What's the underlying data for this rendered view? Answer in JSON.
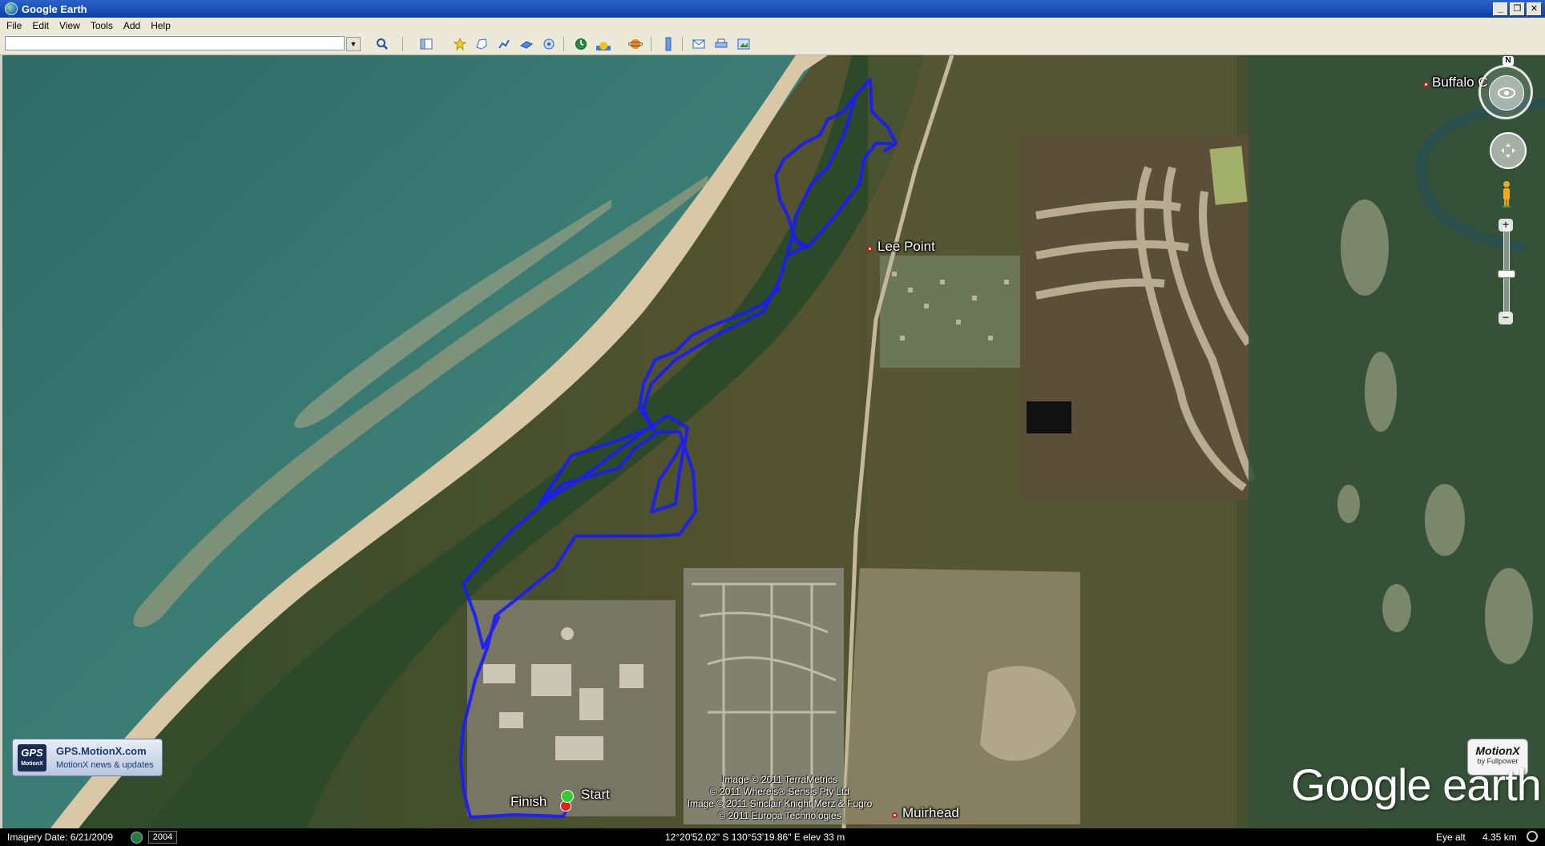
{
  "window": {
    "title": "Google Earth"
  },
  "menu": {
    "file": "File",
    "edit": "Edit",
    "view": "View",
    "tools": "Tools",
    "add": "Add",
    "help": "Help"
  },
  "search": {
    "value": "",
    "placeholder": ""
  },
  "toolbar_icons": [
    "search-icon",
    "sidebar-icon",
    "placemark-icon",
    "polygon-icon",
    "path-icon",
    "overlay-icon",
    "tour-icon",
    "historical-imagery-icon",
    "sun-icon",
    "planets-icon",
    "ruler-icon",
    "email-icon",
    "print-icon",
    "save-image-icon"
  ],
  "places": {
    "buffalo": "Buffalo C",
    "lee_point": "Lee Point",
    "muirhead": "Muirhead",
    "finish": "Finish",
    "start": "Start"
  },
  "credits": {
    "line1": "Image © 2011 TerraMetrics",
    "line2": "© 2011 Whereis® Sensis Pty Ltd",
    "line3": "Image © 2011 Sinclair Knight Merz & Fugro",
    "line4": "© 2011 Europa Technologies"
  },
  "nav": {
    "north": "N"
  },
  "gps_badge": {
    "logo": "GPS",
    "logo_sub": "MotionX",
    "title": "GPS.MotionX.com",
    "subtitle": "MotionX news & updates"
  },
  "motionx_badge": {
    "name": "MotionX",
    "by": "by Fullpower"
  },
  "logo": {
    "text": "Google earth"
  },
  "status": {
    "imagery_date": "Imagery Date: 6/21/2009",
    "year": "2004",
    "coords": "12°20'52.02\" S  130°53'19.86\" E  elev   33 m",
    "eye_alt_label": "Eye alt",
    "eye_alt_value": "4.35 km"
  },
  "colors": {
    "track": "#1a1aff",
    "titlebar": "#0e3ea6",
    "ocean": "#2c6f6a",
    "beach": "#d8c7a6"
  }
}
